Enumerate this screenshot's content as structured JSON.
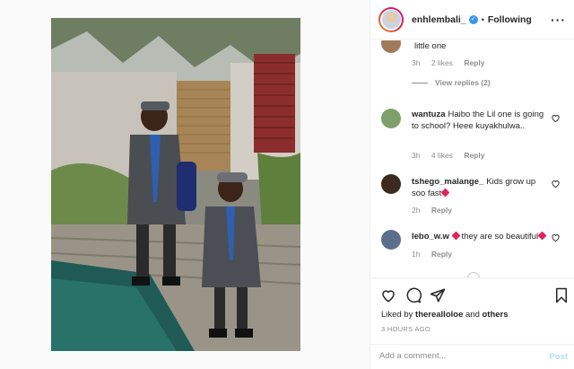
{
  "header": {
    "username": "enhlembali_",
    "separator": "•",
    "follow_label": "Following",
    "more_icon": "more-horizontal-icon"
  },
  "comments": [
    {
      "username": "",
      "text": "little one",
      "meta": {
        "time": "3h",
        "likes": "2 likes",
        "reply": "Reply"
      },
      "view_replies": "View replies (2)"
    },
    {
      "username": "wantuza",
      "text": "Haibo the Lil one is going to school? Heee kuyakhulwa..",
      "meta": {
        "time": "3h",
        "likes": "4 likes",
        "reply": "Reply"
      }
    },
    {
      "username": "tshego_malange_",
      "text": "Kids grow up soo fast",
      "meta": {
        "time": "2h",
        "reply": "Reply"
      }
    },
    {
      "username": "lebo_w.w",
      "text": "they are so beautiful",
      "meta": {
        "time": "1h",
        "reply": "Reply"
      }
    }
  ],
  "actions": {
    "liked_prefix": "Liked by",
    "liked_user": "therealloloe",
    "liked_and": "and",
    "liked_others": "others",
    "time_ago": "3 HOURS AGO"
  },
  "add_comment": {
    "placeholder": "Add a comment...",
    "post_label": "Post"
  },
  "colors": {
    "verified": "#3897f0",
    "post_disabled": "#b2dffc",
    "meta_gray": "#8e8e8e"
  }
}
